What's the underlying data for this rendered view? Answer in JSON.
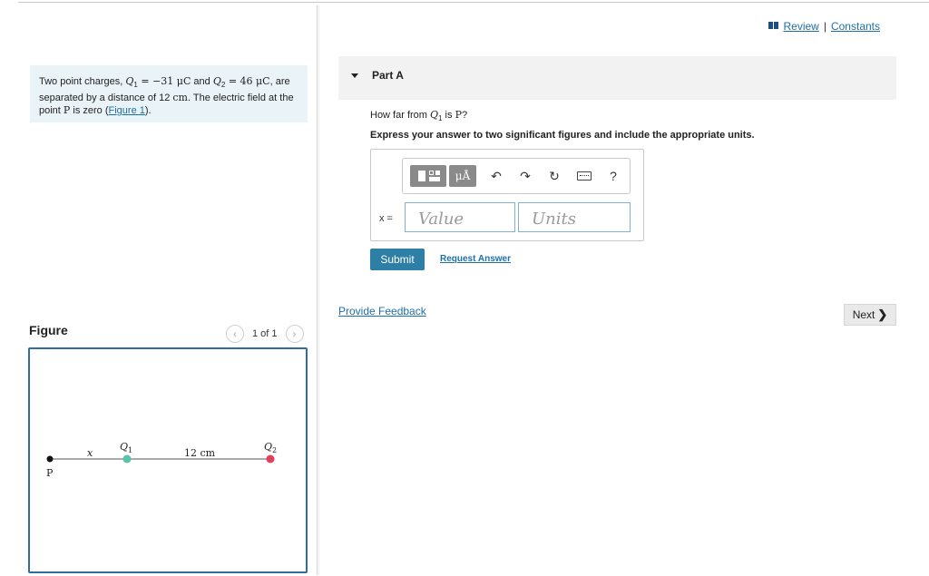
{
  "links": {
    "review": "Review",
    "separator": "|",
    "constants": "Constants"
  },
  "problem": {
    "t1": "Two point charges, ",
    "q1_sym": "Q",
    "q1_sub": "1",
    "q1_val": " = −31 μC",
    "t2": " and ",
    "q2_sym": "Q",
    "q2_sub": "2",
    "q2_val": " = 46 μC",
    "t3": ", are separated by a distance of 12 ",
    "cm": "cm",
    "t4": ". The electric field at the point ",
    "p": "P",
    "t5": " is zero (",
    "figure_link": "Figure 1",
    "t6": ")."
  },
  "figure": {
    "title": "Figure",
    "pager": "1 of 1",
    "labels": {
      "x": "x",
      "q1": "Q",
      "q1_sub": "1",
      "dist": "12 cm",
      "q2": "Q",
      "q2_sub": "2",
      "p": "P"
    },
    "colors": {
      "q1": "#5cc2a8",
      "q2": "#e0405e",
      "p": "#111111",
      "line": "#555555"
    }
  },
  "part": {
    "label": "Part A"
  },
  "question": {
    "pre": "How far from ",
    "q": "Q",
    "q_sub": "1",
    "mid": " is ",
    "p": "P",
    "end": "?"
  },
  "instruction": "Express your answer to two significant figures and include the appropriate units.",
  "toolbar": {
    "units_label": "μÅ",
    "undo_icon": "↶",
    "redo_icon": "↷",
    "reset_icon": "↻",
    "help": "?"
  },
  "answer": {
    "var_label": "x =",
    "value_placeholder": "Value",
    "units_placeholder": "Units"
  },
  "buttons": {
    "submit": "Submit",
    "request_answer": "Request Answer",
    "next": "Next",
    "next_chevron": "❯"
  },
  "feedback": "Provide Feedback",
  "colors": {
    "accent": "#2e7fa6",
    "link": "#1e6fa8",
    "figure_border": "#2e6da4",
    "problem_bg": "#eaf3f7"
  }
}
